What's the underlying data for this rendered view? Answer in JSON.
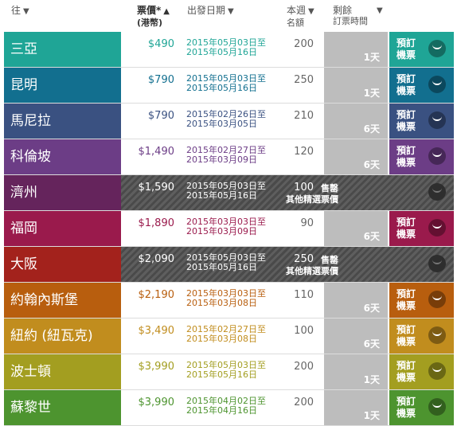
{
  "header": {
    "destination": "往",
    "price": "票價*",
    "price_sub": "(港幣)",
    "departure": "出發日期",
    "avail_line1": "本週",
    "avail_line2": "名額",
    "remain_line1": "剩餘",
    "remain_line2": "訂票時間"
  },
  "book_label_1": "預訂",
  "book_label_2": "機票",
  "sold_out_1": "售罄",
  "sold_out_2": "其他精選票價",
  "rows": [
    {
      "dest": "三亞",
      "price": "$490",
      "date1": "2015年05月03日至",
      "date2": "2015年05月16日",
      "avail": "200",
      "days": "1天",
      "color": "#1fa596",
      "sold": false
    },
    {
      "dest": "昆明",
      "price": "$790",
      "date1": "2015年05月03日至",
      "date2": "2015年05月16日",
      "avail": "250",
      "days": "1天",
      "color": "#126f8f",
      "sold": false
    },
    {
      "dest": "馬尼拉",
      "price": "$790",
      "date1": "2015年02月26日至",
      "date2": "2015年03月05日",
      "avail": "210",
      "days": "6天",
      "color": "#3a5181",
      "sold": false
    },
    {
      "dest": "科倫坡",
      "price": "$1,490",
      "date1": "2015年02月27日至",
      "date2": "2015年03月09日",
      "avail": "120",
      "days": "6天",
      "color": "#6c3d86",
      "sold": false
    },
    {
      "dest": "濟州",
      "price": "$1,590",
      "date1": "2015年05月03日至",
      "date2": "2015年05月16日",
      "avail": "100",
      "days": "",
      "color": "#65245c",
      "sold": true
    },
    {
      "dest": "福岡",
      "price": "$1,890",
      "date1": "2015年03月03日至",
      "date2": "2015年03月09日",
      "avail": "90",
      "days": "6天",
      "color": "#9a1a4c",
      "sold": false
    },
    {
      "dest": "大阪",
      "price": "$2,090",
      "date1": "2015年05月03日至",
      "date2": "2015年05月16日",
      "avail": "250",
      "days": "",
      "color": "#a3221c",
      "sold": true
    },
    {
      "dest": "約翰內斯堡",
      "price": "$2,190",
      "date1": "2015年03月03日至",
      "date2": "2015年03月08日",
      "avail": "110",
      "days": "6天",
      "color": "#b85e0e",
      "sold": false
    },
    {
      "dest": "紐約 (紐瓦克)",
      "price": "$3,490",
      "date1": "2015年02月27日至",
      "date2": "2015年03月08日",
      "avail": "100",
      "days": "6天",
      "color": "#c18d1e",
      "sold": false
    },
    {
      "dest": "波士頓",
      "price": "$3,990",
      "date1": "2015年05月03日至",
      "date2": "2015年05月16日",
      "avail": "200",
      "days": "1天",
      "color": "#a39e20",
      "sold": false
    },
    {
      "dest": "蘇黎世",
      "price": "$3,990",
      "date1": "2015年04月02日至",
      "date2": "2015年04月16日",
      "avail": "200",
      "days": "1天",
      "color": "#4d942f",
      "sold": false
    }
  ]
}
